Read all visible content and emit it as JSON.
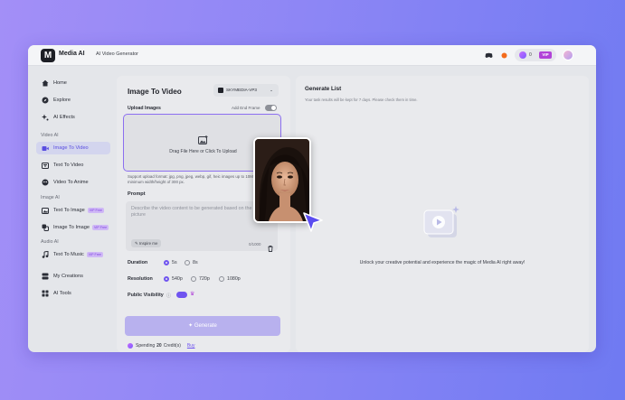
{
  "topbar": {
    "brand": "Media AI",
    "breadcrumb": "AI Video Generator",
    "credits": "0",
    "vip_label": "VIP"
  },
  "sidebar": {
    "items": [
      {
        "label": "Home",
        "icon": "home-icon"
      },
      {
        "label": "Explore",
        "icon": "compass-icon"
      },
      {
        "label": "AI Effects",
        "icon": "sparkle-icon"
      }
    ],
    "section_video": "Video AI",
    "video_items": [
      {
        "label": "Image To Video",
        "active": true
      },
      {
        "label": "Text To Video"
      },
      {
        "label": "Video To Anime"
      }
    ],
    "section_image": "Image AI",
    "image_items": [
      {
        "label": "Text To Image",
        "badge": "VIP Free"
      },
      {
        "label": "Image To Image",
        "badge": "VIP Free"
      }
    ],
    "section_audio": "Audio AI",
    "audio_items": [
      {
        "label": "Text To Music",
        "badge": "VIP Free"
      }
    ],
    "bottom_items": [
      {
        "label": "My Creations"
      },
      {
        "label": "AI Tools"
      }
    ]
  },
  "form": {
    "title": "Image To Video",
    "model": "SKYMEDIA-VP3",
    "upload_label": "Upload Images",
    "end_frame_label": "Add End Frame",
    "upload_text": "Drag File Here or Click To Upload",
    "upload_hint": "Support upload format: jpg, png, jpeg, webp, gif, heic images up to 10MB, with a minimum width/height of 300 px.",
    "prompt_label": "Prompt",
    "prompt_placeholder": "Describe the video content to be generated based on the picture",
    "inspire_label": "Inspire me",
    "char_count": "0/1000",
    "duration_label": "Duration",
    "duration_options": [
      "5s",
      "8s"
    ],
    "resolution_label": "Resolution",
    "resolution_options": [
      "540p",
      "720p",
      "1080p"
    ],
    "visibility_label": "Public Visibility",
    "generate_label": "Generate",
    "spend_prefix": "Spending",
    "spend_amount": "20",
    "spend_suffix": "Credit(s)",
    "buy_label": "Buy"
  },
  "result": {
    "title": "Generate List",
    "subtitle": "Your task results will be kept for 7 days. Please check them in time.",
    "empty_text": "Unlock your creative potential and experience the magic of Media AI right away!"
  },
  "colors": {
    "accent": "#6f54f0",
    "background_gradient": [
      "#a38ff7",
      "#6f7af2"
    ],
    "vip": "#b143d8"
  }
}
